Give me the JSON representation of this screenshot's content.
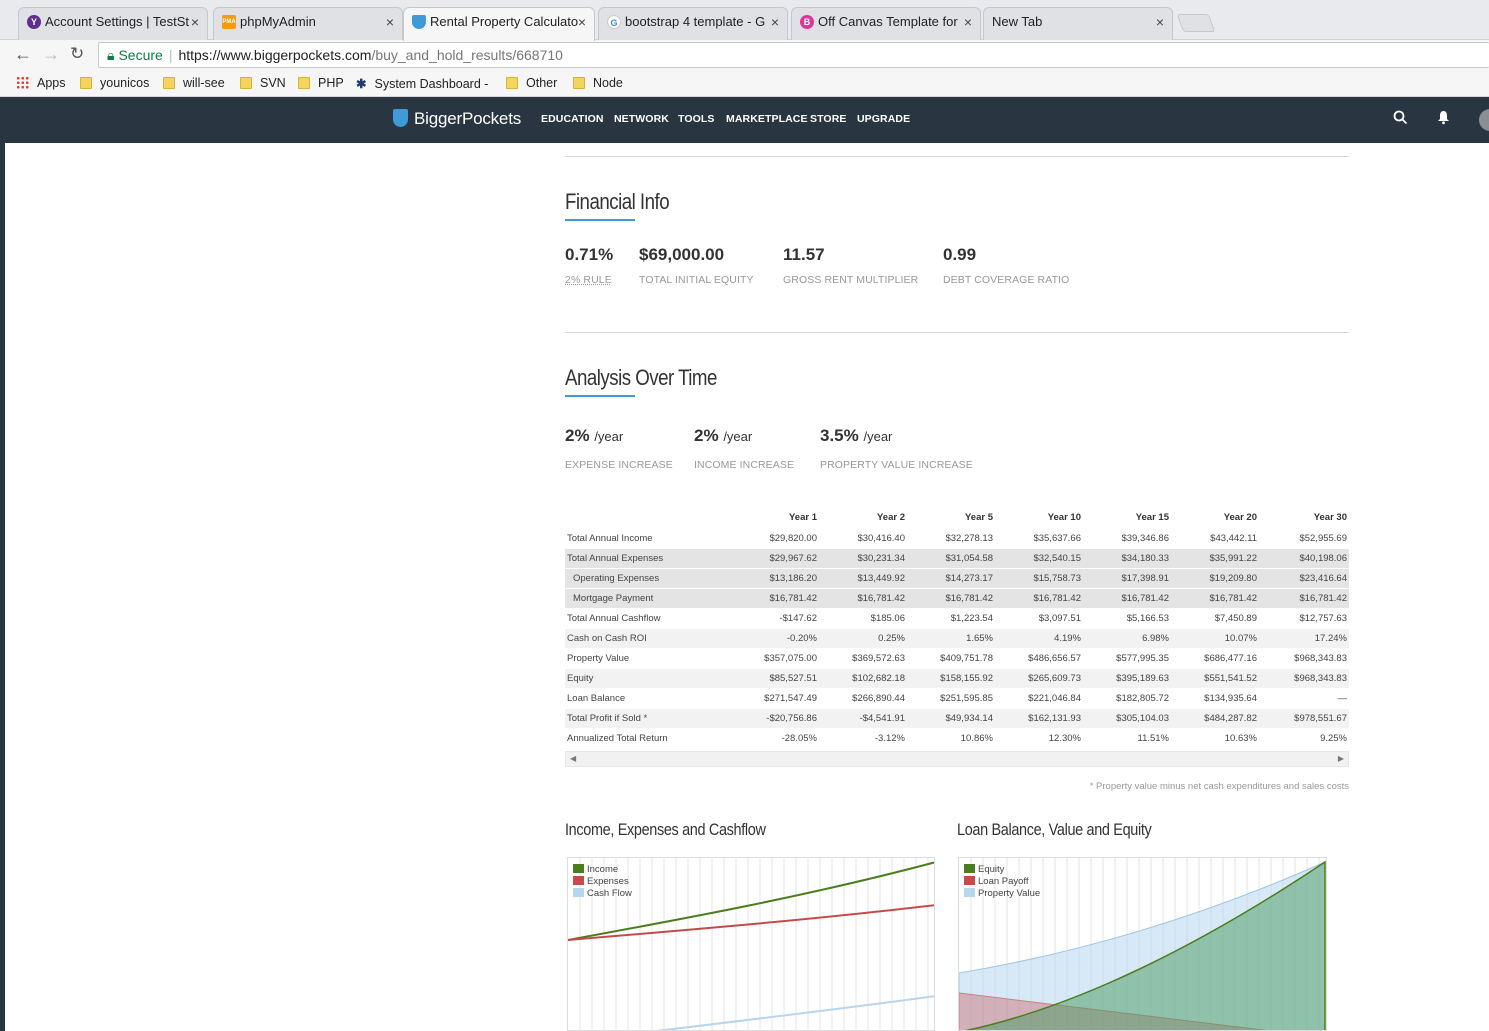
{
  "browser": {
    "tabs": [
      {
        "title": "Account Settings | TestSt",
        "icon": "yahoo-icon"
      },
      {
        "title": "phpMyAdmin",
        "icon": "phpmyadmin-icon"
      },
      {
        "title": "Rental Property Calculato",
        "icon": "biggerpockets-icon"
      },
      {
        "title": "bootstrap 4 template - G",
        "icon": "google-icon"
      },
      {
        "title": "Off Canvas Template for",
        "icon": "bootstrap-icon"
      },
      {
        "title": "New Tab",
        "icon": ""
      }
    ],
    "close_glyph": "×",
    "secure_label": "Secure",
    "url_host": "https://www.biggerpockets.com",
    "url_path": "/buy_and_hold_results/668710",
    "bookmarks": [
      "Apps",
      "younicos",
      "will-see",
      "SVN",
      "PHP",
      "System Dashboard -",
      "Other",
      "Node"
    ]
  },
  "site": {
    "logo": "BiggerPockets",
    "nav": [
      "EDUCATION",
      "NETWORK",
      "TOOLS",
      "MARKETPLACE",
      "STORE",
      "UPGRADE"
    ]
  },
  "financial_info": {
    "title": "Financial Info",
    "metrics": [
      {
        "value": "0.71%",
        "label": "2% RULE"
      },
      {
        "value": "$69,000.00",
        "label": "TOTAL INITIAL EQUITY"
      },
      {
        "value": "11.57",
        "label": "GROSS RENT MULTIPLIER"
      },
      {
        "value": "0.99",
        "label": "DEBT COVERAGE RATIO"
      }
    ]
  },
  "analysis": {
    "title": "Analysis Over Time",
    "metrics": [
      {
        "value": "2%",
        "unit": "/year",
        "label": "EXPENSE INCREASE"
      },
      {
        "value": "2%",
        "unit": "/year",
        "label": "INCOME INCREASE"
      },
      {
        "value": "3.5%",
        "unit": "/year",
        "label": "PROPERTY VALUE INCREASE"
      }
    ],
    "table": {
      "headers": [
        "",
        "Year 1",
        "Year 2",
        "Year 5",
        "Year 10",
        "Year 15",
        "Year 20",
        "Year 30"
      ],
      "rows": [
        {
          "label": "Total Annual Income",
          "values": [
            "$29,820.00",
            "$30,416.40",
            "$32,278.13",
            "$35,637.66",
            "$39,346.86",
            "$43,442.11",
            "$52,955.69"
          ]
        },
        {
          "label": "Total Annual Expenses",
          "values": [
            "$29,967.62",
            "$30,231.34",
            "$31,054.58",
            "$32,540.15",
            "$34,180.33",
            "$35,991.22",
            "$40,198.06"
          ]
        },
        {
          "label": "Operating Expenses",
          "values": [
            "$13,186.20",
            "$13,449.92",
            "$14,273.17",
            "$15,758.73",
            "$17,398.91",
            "$19,209.80",
            "$23,416.64"
          ]
        },
        {
          "label": "Mortgage Payment",
          "values": [
            "$16,781.42",
            "$16,781.42",
            "$16,781.42",
            "$16,781.42",
            "$16,781.42",
            "$16,781.42",
            "$16,781.42"
          ]
        },
        {
          "label": "Total Annual Cashflow",
          "values": [
            "-$147.62",
            "$185.06",
            "$1,223.54",
            "$3,097.51",
            "$5,166.53",
            "$7,450.89",
            "$12,757.63"
          ]
        },
        {
          "label": "Cash on Cash ROI",
          "values": [
            "-0.20%",
            "0.25%",
            "1.65%",
            "4.19%",
            "6.98%",
            "10.07%",
            "17.24%"
          ]
        },
        {
          "label": "Property Value",
          "values": [
            "$357,075.00",
            "$369,572.63",
            "$409,751.78",
            "$486,656.57",
            "$577,995.35",
            "$686,477.16",
            "$968,343.83"
          ]
        },
        {
          "label": "Equity",
          "values": [
            "$85,527.51",
            "$102,682.18",
            "$158,155.92",
            "$265,609.73",
            "$395,189.63",
            "$551,541.52",
            "$968,343.83"
          ]
        },
        {
          "label": "Loan Balance",
          "values": [
            "$271,547.49",
            "$266,890.44",
            "$251,595.85",
            "$221,046.84",
            "$182,805.72",
            "$134,935.64",
            "—"
          ]
        },
        {
          "label": "Total Profit if Sold *",
          "values": [
            "-$20,756.86",
            "-$4,541.91",
            "$49,934.14",
            "$162,131.93",
            "$305,104.03",
            "$484,287.82",
            "$978,551.67"
          ]
        },
        {
          "label": "Annualized Total Return",
          "values": [
            "-28.05%",
            "-3.12%",
            "10.86%",
            "12.30%",
            "11.51%",
            "10.63%",
            "9.25%"
          ]
        }
      ]
    },
    "footnote": "* Property value minus net cash expenditures and sales costs"
  },
  "charts": {
    "left_title": "Income, Expenses and Cashflow",
    "right_title": "Loan Balance, Value and Equity",
    "left_legend": [
      {
        "name": "Income",
        "color": "#4a7d1d"
      },
      {
        "name": "Expenses",
        "color": "#c9494b"
      },
      {
        "name": "Cash Flow",
        "color": "#b6d6ee"
      }
    ],
    "right_legend": [
      {
        "name": "Equity",
        "color": "#4a7d1d"
      },
      {
        "name": "Loan Payoff",
        "color": "#c9494b"
      },
      {
        "name": "Property Value",
        "color": "#b6d6ee"
      }
    ]
  }
}
